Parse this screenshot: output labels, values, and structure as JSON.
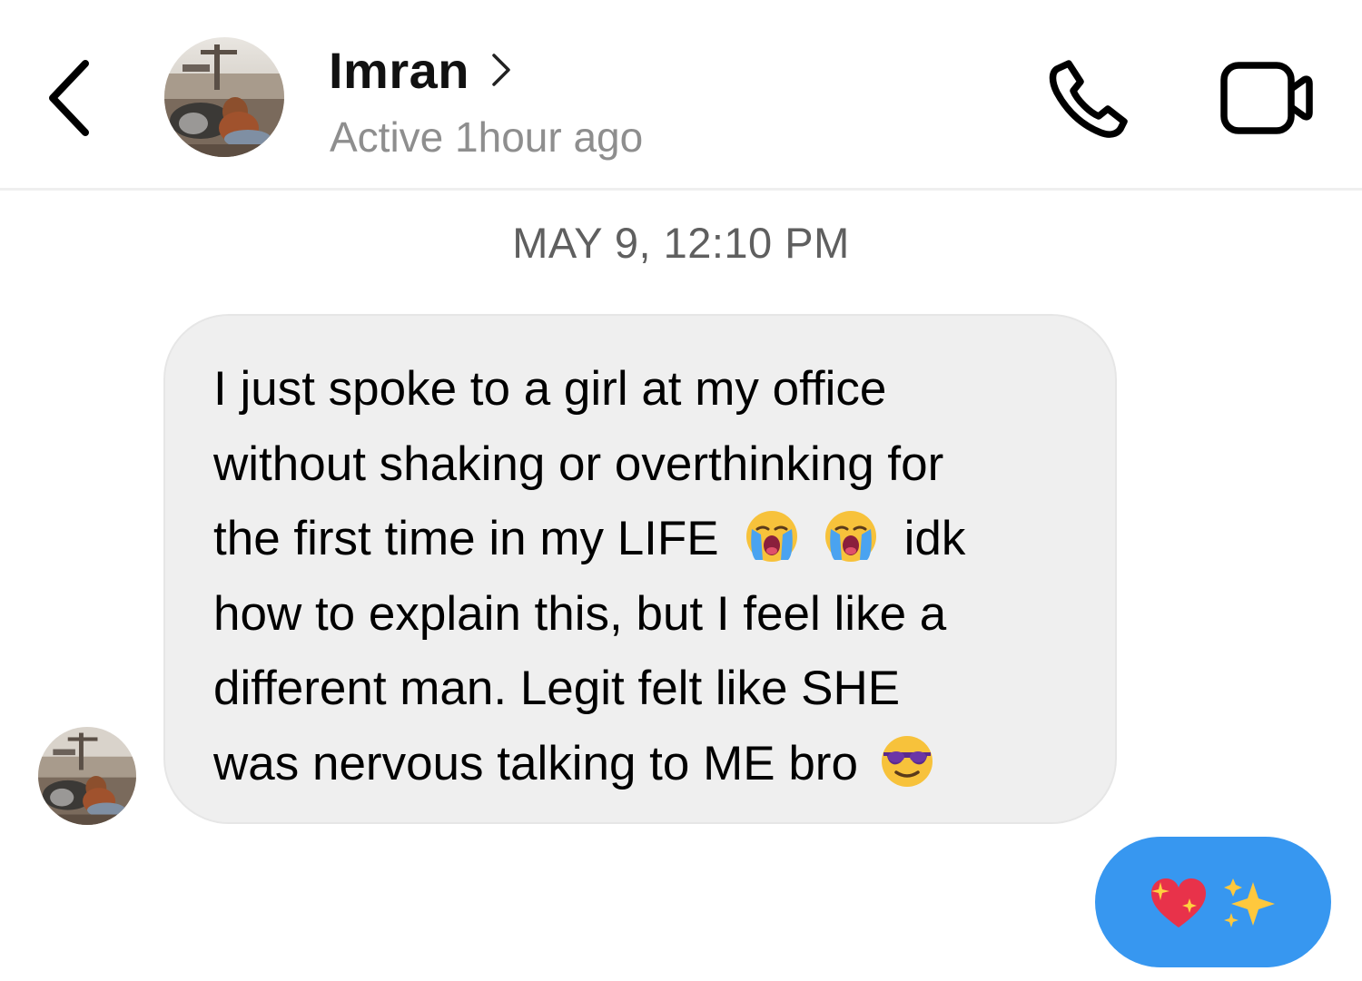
{
  "header": {
    "contact_name": "Imran",
    "status": "Active 1hour ago",
    "back_icon": "chevron-left-icon",
    "call_icon": "phone-icon",
    "video_icon": "video-camera-icon",
    "name_chevron_icon": "chevron-right-icon"
  },
  "conversation": {
    "timestamp": "MAY 9, 12:10 PM",
    "incoming_message": {
      "lines": [
        [
          "I just spoke to a girl at my office"
        ],
        [
          "without shaking or overthinking for"
        ],
        [
          "the first time in my LIFE",
          "😭",
          "😭",
          "idk"
        ],
        [
          "how to explain this, but I feel like a"
        ],
        [
          "different man. Legit felt like SHE"
        ],
        [
          "was nervous talking to ME bro",
          "😎"
        ]
      ],
      "text_parts": {
        "l1": "I just spoke to a girl at my office",
        "l2": "without shaking or overthinking for",
        "l3a": "the first time in my LIFE",
        "l3b": "idk",
        "l4": "how to explain this, but I feel like a",
        "l5": "different man. Legit felt like SHE",
        "l6": "was nervous talking to ME bro"
      },
      "emojis": {
        "crying_1": "loudly-crying-face",
        "crying_2": "loudly-crying-face",
        "sunglasses": "smiling-face-with-sunglasses"
      }
    },
    "outgoing_reaction": {
      "emojis": [
        "sparkling-heart",
        "sparkles"
      ]
    }
  },
  "colors": {
    "bubble_incoming": "#efefef",
    "bubble_outgoing": "#3797f0",
    "status_text": "#8e8e8e",
    "timestamp_text": "#5f5f5f"
  }
}
